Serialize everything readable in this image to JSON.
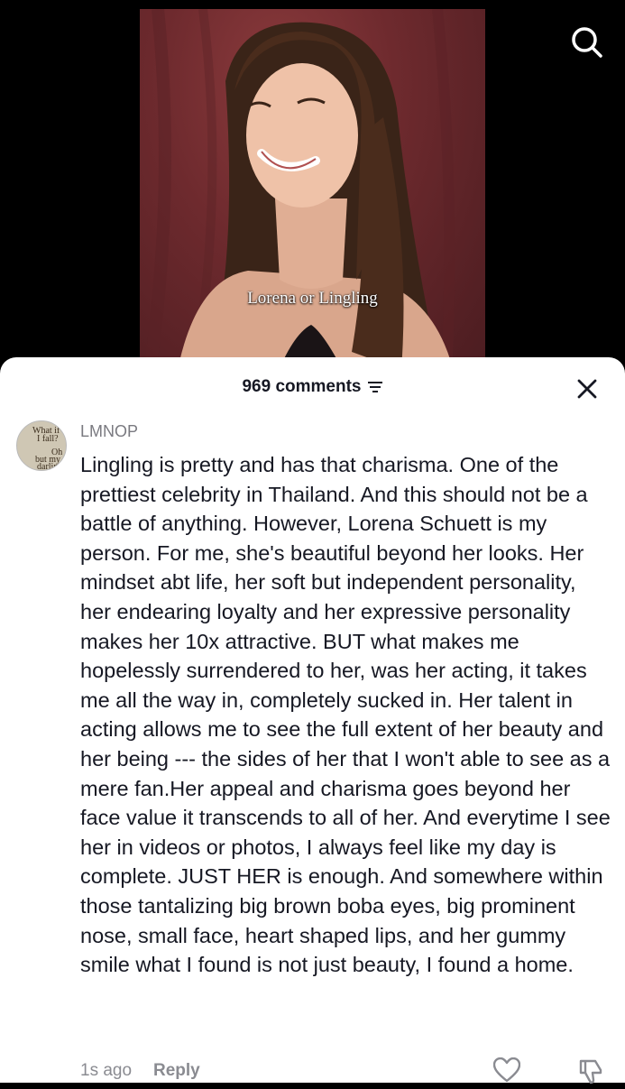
{
  "video": {
    "caption": "Lorena or Lingling"
  },
  "icons": {
    "search": "search-icon",
    "sort": "sort-icon",
    "close": "close-icon",
    "like": "heart-icon",
    "dislike": "thumbs-down-icon"
  },
  "comments_sheet": {
    "count_label": "969 comments"
  },
  "comment": {
    "avatar_text": [
      "What if",
      "I fall?",
      "Oh",
      "but my",
      "darling"
    ],
    "username": "LMNOP",
    "text": "Lingling is pretty and has that charisma. One of the prettiest celebrity in Thailand. And this should not be a battle of anything. However, Lorena Schuett is my person. For me, she's beautiful beyond her looks. Her mindset abt life, her soft but independent personality, her endearing loyalty and her expressive personality makes her 10x attractive. BUT what makes me hopelessly surrendered to her, was her acting, it takes me all the way in, completely sucked in. Her talent in acting allows me to see the full extent of her beauty and her being --- the sides of her that I won't able to see as a mere fan.Her appeal and charisma goes beyond her face value it transcends to all of her. And everytime I see her in videos or photos, I always feel like my day is complete. JUST HER is enough. And somewhere within those tantalizing big brown boba eyes, big prominent nose, small face, heart shaped lips, and her gummy smile what I found is not just beauty, I found a home.",
    "timestamp": "1s ago",
    "reply_label": "Reply"
  },
  "colors": {
    "sheet_background": "#ffffff",
    "primary_text": "#161823",
    "secondary_text": "#8a8b91"
  }
}
